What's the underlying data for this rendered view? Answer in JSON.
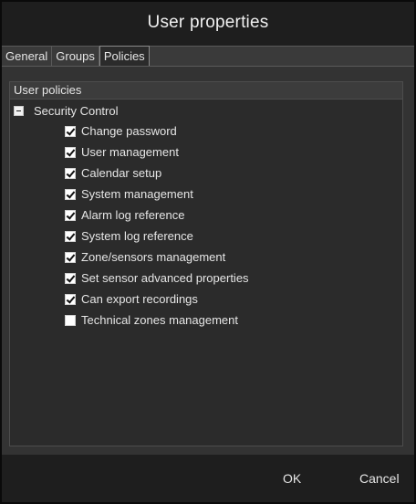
{
  "dialog": {
    "title": "User properties"
  },
  "tabs": [
    {
      "label": "General",
      "active": false
    },
    {
      "label": "Groups",
      "active": false
    },
    {
      "label": "Policies",
      "active": true
    }
  ],
  "policies_panel": {
    "header": "User policies",
    "group_label": "Security Control",
    "group_expanded": true,
    "items": [
      {
        "label": "Change password",
        "checked": true
      },
      {
        "label": "User management",
        "checked": true
      },
      {
        "label": "Calendar setup",
        "checked": true
      },
      {
        "label": "System management",
        "checked": true
      },
      {
        "label": "Alarm log reference",
        "checked": true
      },
      {
        "label": "System log reference",
        "checked": true
      },
      {
        "label": "Zone/sensors management",
        "checked": true
      },
      {
        "label": "Set sensor advanced properties",
        "checked": true
      },
      {
        "label": "Can export recordings",
        "checked": true
      },
      {
        "label": "Technical zones management",
        "checked": false
      }
    ]
  },
  "footer": {
    "ok_label": "OK",
    "cancel_label": "Cancel"
  },
  "colors": {
    "background": "#1e1e1e",
    "content": "#333333",
    "panel": "#2b2b2b",
    "text": "#e6e6e6"
  }
}
